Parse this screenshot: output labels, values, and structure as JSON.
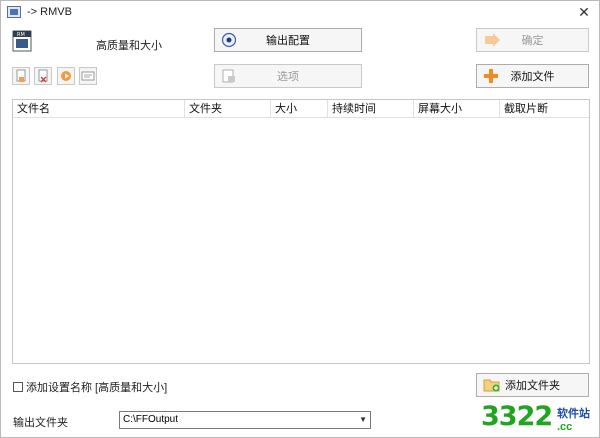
{
  "window": {
    "title": "-> RMVB",
    "close_glyph": "✕"
  },
  "preset": {
    "label": "高质量和大小",
    "icon": "video-file-icon"
  },
  "buttons": {
    "output_config": "输出配置",
    "confirm": "确定",
    "options": "选项",
    "add_file": "添加文件",
    "add_folder": "添加文件夹"
  },
  "toolbar": {
    "icons": [
      "new-file-icon",
      "remove-file-icon",
      "play-icon",
      "info-icon"
    ]
  },
  "table": {
    "columns": [
      "文件名",
      "文件夹",
      "大小",
      "持续时间",
      "屏幕大小",
      "截取片断"
    ],
    "rows": []
  },
  "footer": {
    "checkbox_label": "添加设置名称 [高质量和大小]",
    "checkbox_checked": false,
    "output_folder_label": "输出文件夹",
    "output_folder_value": "C:\\FFOutput"
  },
  "watermark": {
    "number": "3322",
    "text": "软件站",
    "domain": ".cc"
  },
  "colors": {
    "accent_orange": "#f28c1e",
    "watermark_green": "#1fa51f"
  }
}
